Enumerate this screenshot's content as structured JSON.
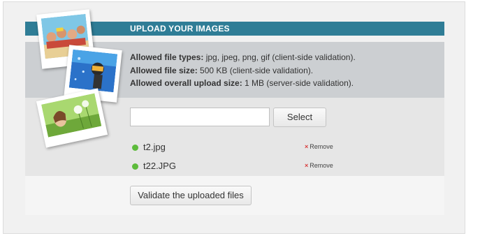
{
  "header": {
    "title": "UPLOAD YOUR IMAGES"
  },
  "rules": [
    {
      "label": "Allowed file types:",
      "value": " jpg, jpeg, png, gif (client-side validation)."
    },
    {
      "label": "Allowed file size:",
      "value": " 500 KB (client-side validation)."
    },
    {
      "label": "Allowed overall upload size:",
      "value": " 1 MB (server-side validation)."
    }
  ],
  "upload": {
    "file_input_value": "",
    "select_label": "Select",
    "files": [
      {
        "name": "t2.jpg",
        "remove_label": "Remove",
        "status": "uploaded"
      },
      {
        "name": "t22.JPG",
        "remove_label": "Remove",
        "status": "uploaded"
      }
    ]
  },
  "footer": {
    "validate_label": "Validate the uploaded files"
  },
  "colors": {
    "header_bg": "#2f7d96",
    "status_ok": "#5dbb3b",
    "remove_x": "#d93b3b"
  },
  "photos": [
    "family-beach-photo",
    "underwater-diver-photo",
    "dandelion-girl-photo"
  ]
}
